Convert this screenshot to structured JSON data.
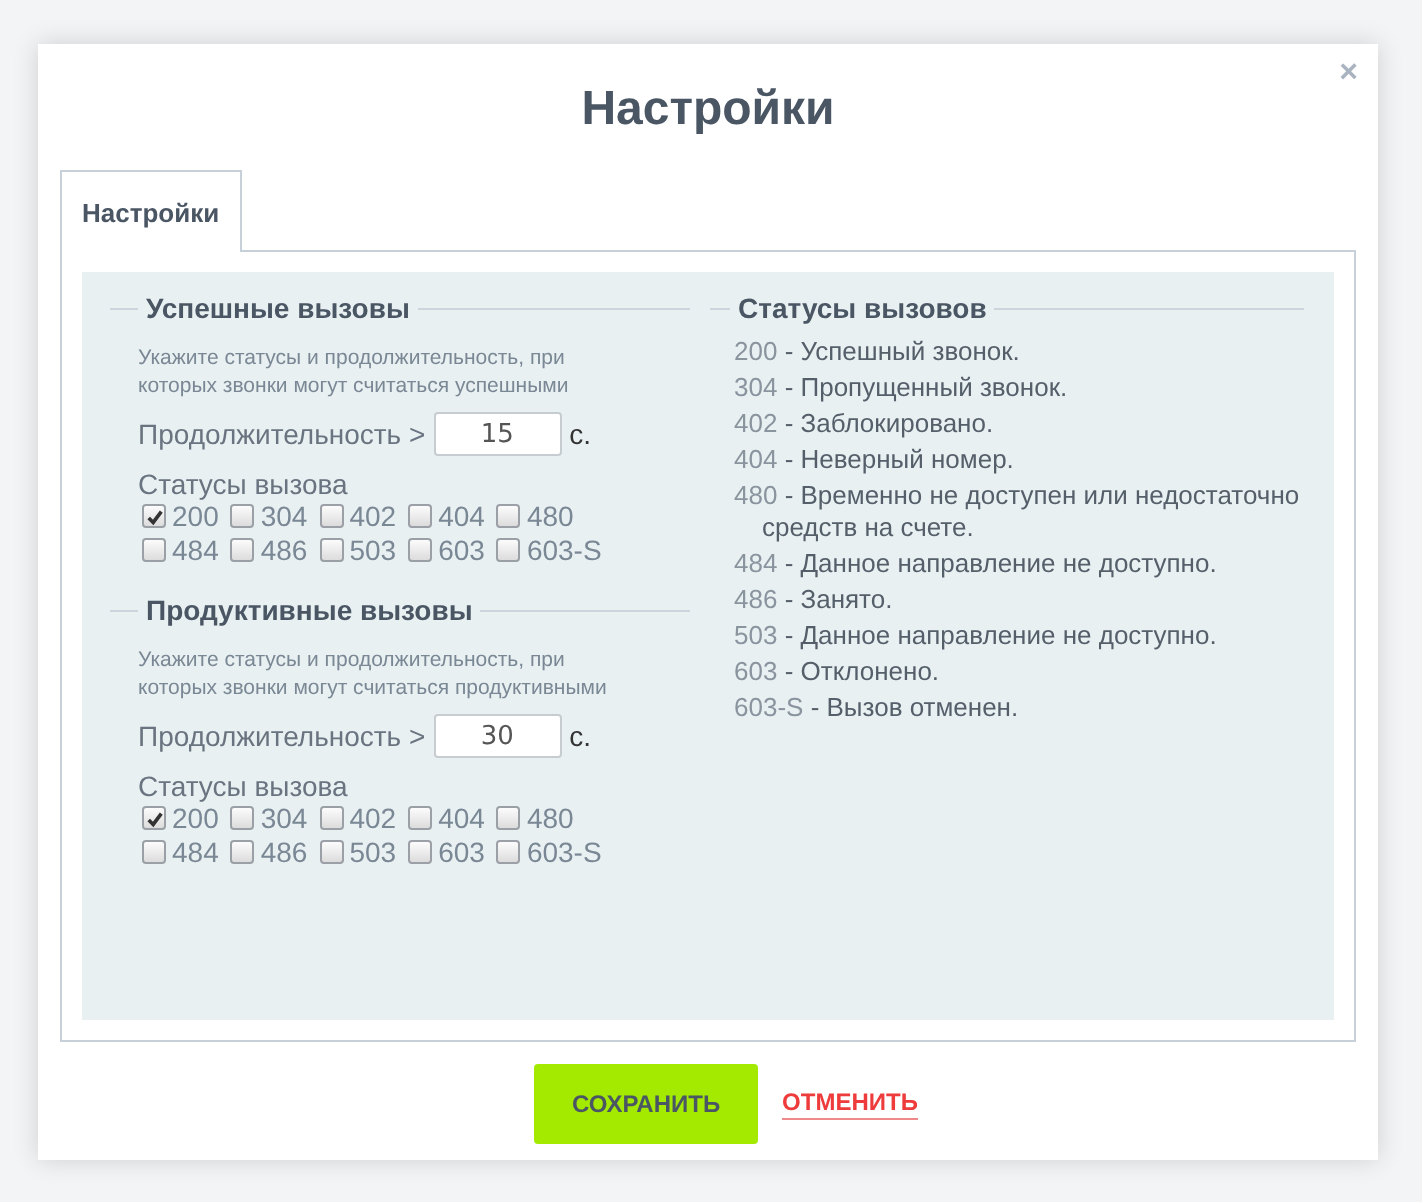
{
  "dialog": {
    "title": "Настройки",
    "close": "×"
  },
  "tabs": [
    {
      "label": "Настройки",
      "selected": true
    }
  ],
  "groups": [
    {
      "title": "Успешные вызовы",
      "hint": "Укажите статусы и продолжительность, при которых звонки могут считаться успешными",
      "duration_label": "Продолжительность >",
      "duration": "15",
      "unit": "с.",
      "statuses_label": "Статусы вызова",
      "statuses": [
        {
          "label": "200",
          "checked": true
        },
        {
          "label": "304",
          "checked": false
        },
        {
          "label": "402",
          "checked": false
        },
        {
          "label": "404",
          "checked": false
        },
        {
          "label": "480",
          "checked": false
        },
        {
          "label": "484",
          "checked": false
        },
        {
          "label": "486",
          "checked": false
        },
        {
          "label": "503",
          "checked": false
        },
        {
          "label": "603",
          "checked": false
        },
        {
          "label": "603-S",
          "checked": false
        }
      ]
    },
    {
      "title": "Продуктивные вызовы",
      "hint": "Укажите статусы и продолжительность, при которых звонки могут считаться продуктивными",
      "duration_label": "Продолжительность >",
      "duration": "30",
      "unit": "с.",
      "statuses_label": "Статусы вызова",
      "statuses": [
        {
          "label": "200",
          "checked": true
        },
        {
          "label": "304",
          "checked": false
        },
        {
          "label": "402",
          "checked": false
        },
        {
          "label": "404",
          "checked": false
        },
        {
          "label": "480",
          "checked": false
        },
        {
          "label": "484",
          "checked": false
        },
        {
          "label": "486",
          "checked": false
        },
        {
          "label": "503",
          "checked": false
        },
        {
          "label": "603",
          "checked": false
        },
        {
          "label": "603-S",
          "checked": false
        }
      ]
    }
  ],
  "legend": {
    "title": "Статусы вызовов",
    "items": [
      {
        "code": "200",
        "text": "- Успешный звонок."
      },
      {
        "code": "304",
        "text": "- Пропущенный звонок."
      },
      {
        "code": "402",
        "text": "- Заблокировано."
      },
      {
        "code": "404",
        "text": "- Неверный номер."
      },
      {
        "code": "480",
        "text": "- Временно не доступен или недостаточно средств на счете."
      },
      {
        "code": "484",
        "text": "- Данное направление не доступно."
      },
      {
        "code": "486",
        "text": "- Занято."
      },
      {
        "code": "503",
        "text": "- Данное направление не доступно."
      },
      {
        "code": "603",
        "text": "- Отклонено."
      },
      {
        "code": "603-S",
        "text": "- Вызов отменен."
      }
    ]
  },
  "buttons": {
    "save": "СОХРАНИТЬ",
    "cancel": "ОТМЕНИТЬ"
  }
}
